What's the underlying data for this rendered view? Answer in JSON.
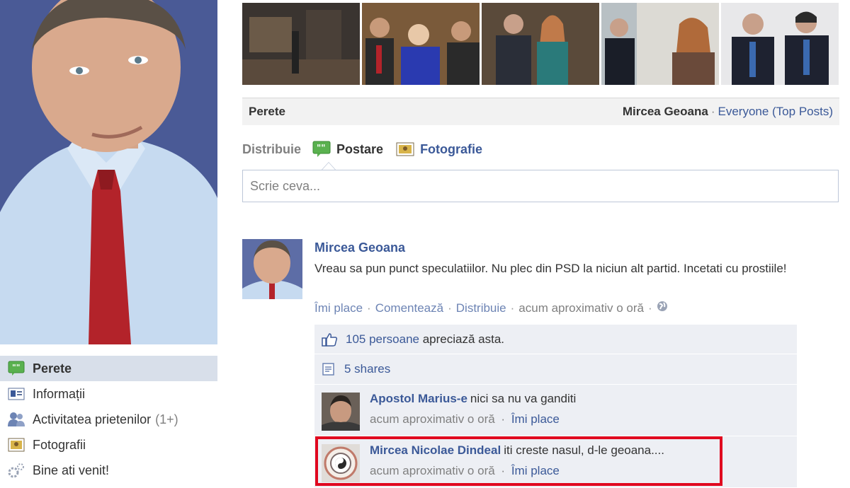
{
  "left_nav": {
    "items": [
      {
        "label": "Perete",
        "active": true,
        "icon": "wall-icon"
      },
      {
        "label": "Informații",
        "icon": "info-icon"
      },
      {
        "label": "Activitatea prietenilor",
        "count": "(1+)",
        "icon": "friends-icon"
      },
      {
        "label": "Fotografii",
        "icon": "photos-icon"
      },
      {
        "label": "Bine ati venit!",
        "icon": "gear-icon"
      }
    ]
  },
  "wall_header": {
    "title": "Perete",
    "owner": "Mircea Geoana",
    "filter": "Everyone (Top Posts)"
  },
  "composer": {
    "share_label": "Distribuie",
    "tab_post": "Postare",
    "tab_photo": "Fotografie",
    "placeholder": "Scrie ceva..."
  },
  "post": {
    "author": "Mircea Geoana",
    "text": "Vreau sa pun punct speculatiilor. Nu plec din PSD la niciun alt partid. Incetati cu prostiile!",
    "like_label": "Îmi place",
    "comment_label": "Comentează",
    "share_label": "Distribuie",
    "timestamp": "acum aproximativ o oră",
    "privacy_icon": "globe-icon"
  },
  "feedback": {
    "likes_link": "105 persoane",
    "likes_suffix": "apreciază asta.",
    "shares": "5 shares"
  },
  "comments": [
    {
      "author": "Apostol Marius-e",
      "text": "nici sa nu va ganditi",
      "timestamp": "acum aproximativ o oră",
      "like_label": "Îmi place"
    },
    {
      "author": "Mircea Nicolae Dindeal",
      "text": "iti creste nasul, d-le geoana....",
      "timestamp": "acum aproximativ o oră",
      "like_label": "Îmi place"
    }
  ],
  "colors": {
    "link": "#3b5998",
    "highlight": "#e0081f",
    "feedback_bg": "#edeff4"
  }
}
